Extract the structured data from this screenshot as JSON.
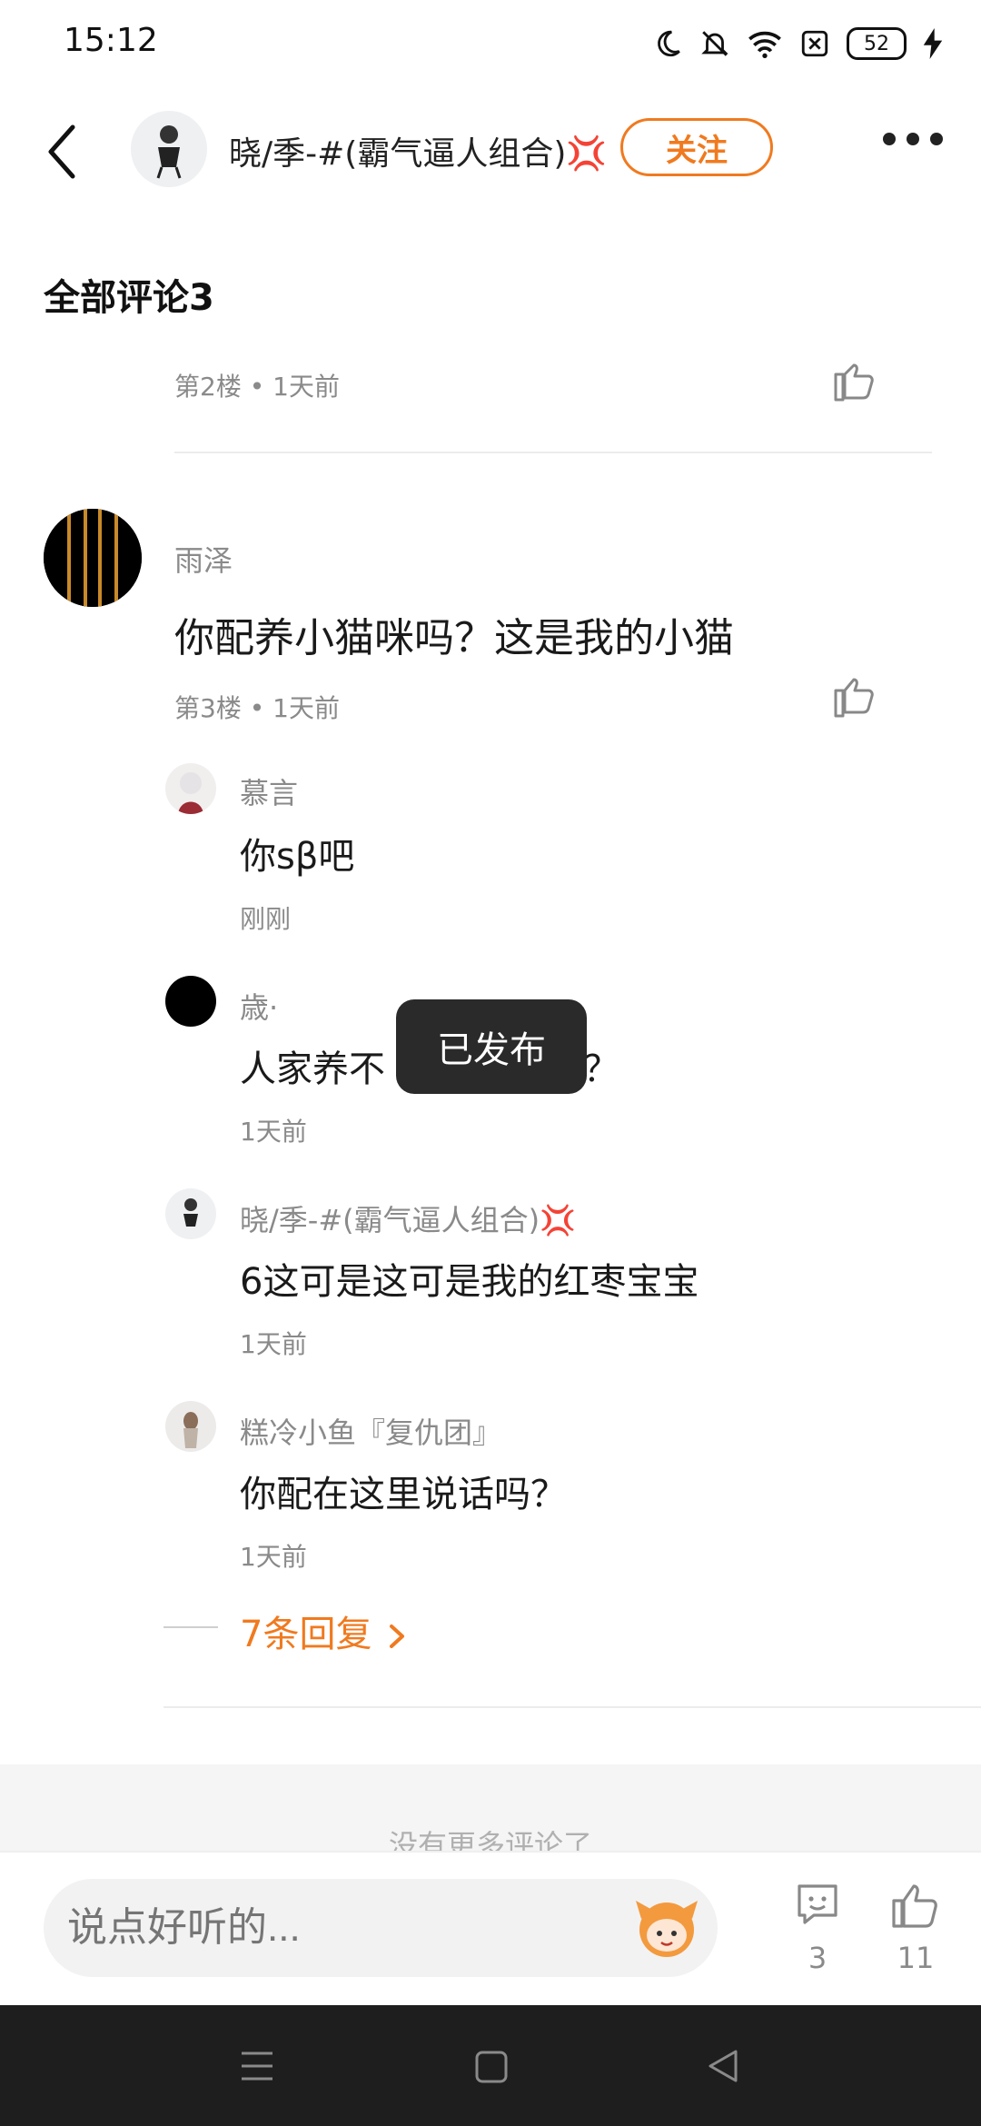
{
  "status_bar": {
    "time": "15:12",
    "battery": "52"
  },
  "header": {
    "user_name": "晓/季-#(霸气逼人组合)💢",
    "follow_label": "关注"
  },
  "section_title": "全部评论3",
  "prev_comment": {
    "meta": "第2楼 • 1天前"
  },
  "comment": {
    "user": "雨泽",
    "text": "你配养小猫咪吗？这是我的小猫",
    "meta": "第3楼 • 1天前"
  },
  "replies": [
    {
      "user": "慕言",
      "text": "你sβ吧",
      "time": "刚刚"
    },
    {
      "user": "歳·",
      "text": "人家养不",
      "text_end": "？",
      "time": "1天前"
    },
    {
      "user": "晓/季-#(霸气逼人组合)💢",
      "text": "6这可是这可是我的红枣宝宝",
      "time": "1天前"
    },
    {
      "user": "糕冷小鱼『复仇团』",
      "text": "你配在这里说话吗？",
      "time": "1天前"
    }
  ],
  "more_replies_label": "7条回复",
  "toast": "已发布",
  "no_more_text": "没有更多评论了",
  "bottom_bar": {
    "input_placeholder": "说点好听的...",
    "comment_count": "3",
    "like_count": "11"
  },
  "colors": {
    "accent": "#f07a1f",
    "toast_bg": "#2a2a2a",
    "nav_bg": "#1e1e1e"
  }
}
